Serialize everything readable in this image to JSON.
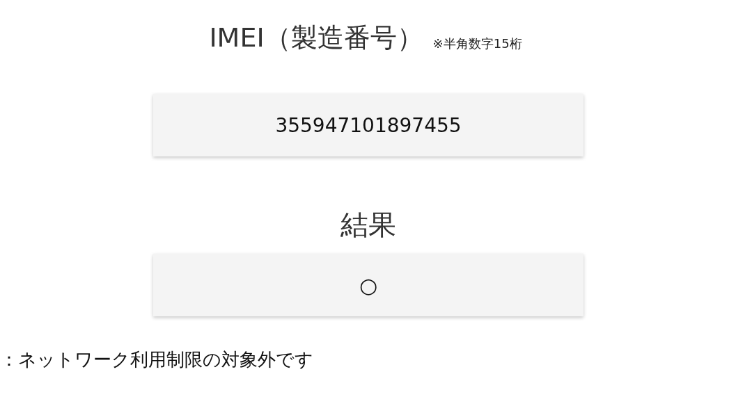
{
  "imei_heading": {
    "title": "IMEI（製造番号）",
    "note": "※半角数字15桁"
  },
  "imei_field": {
    "value": "355947101897455"
  },
  "result_heading": "結果",
  "result_box": {
    "value": "○"
  },
  "result_message": "：ネットワーク利用制限の対象外です"
}
